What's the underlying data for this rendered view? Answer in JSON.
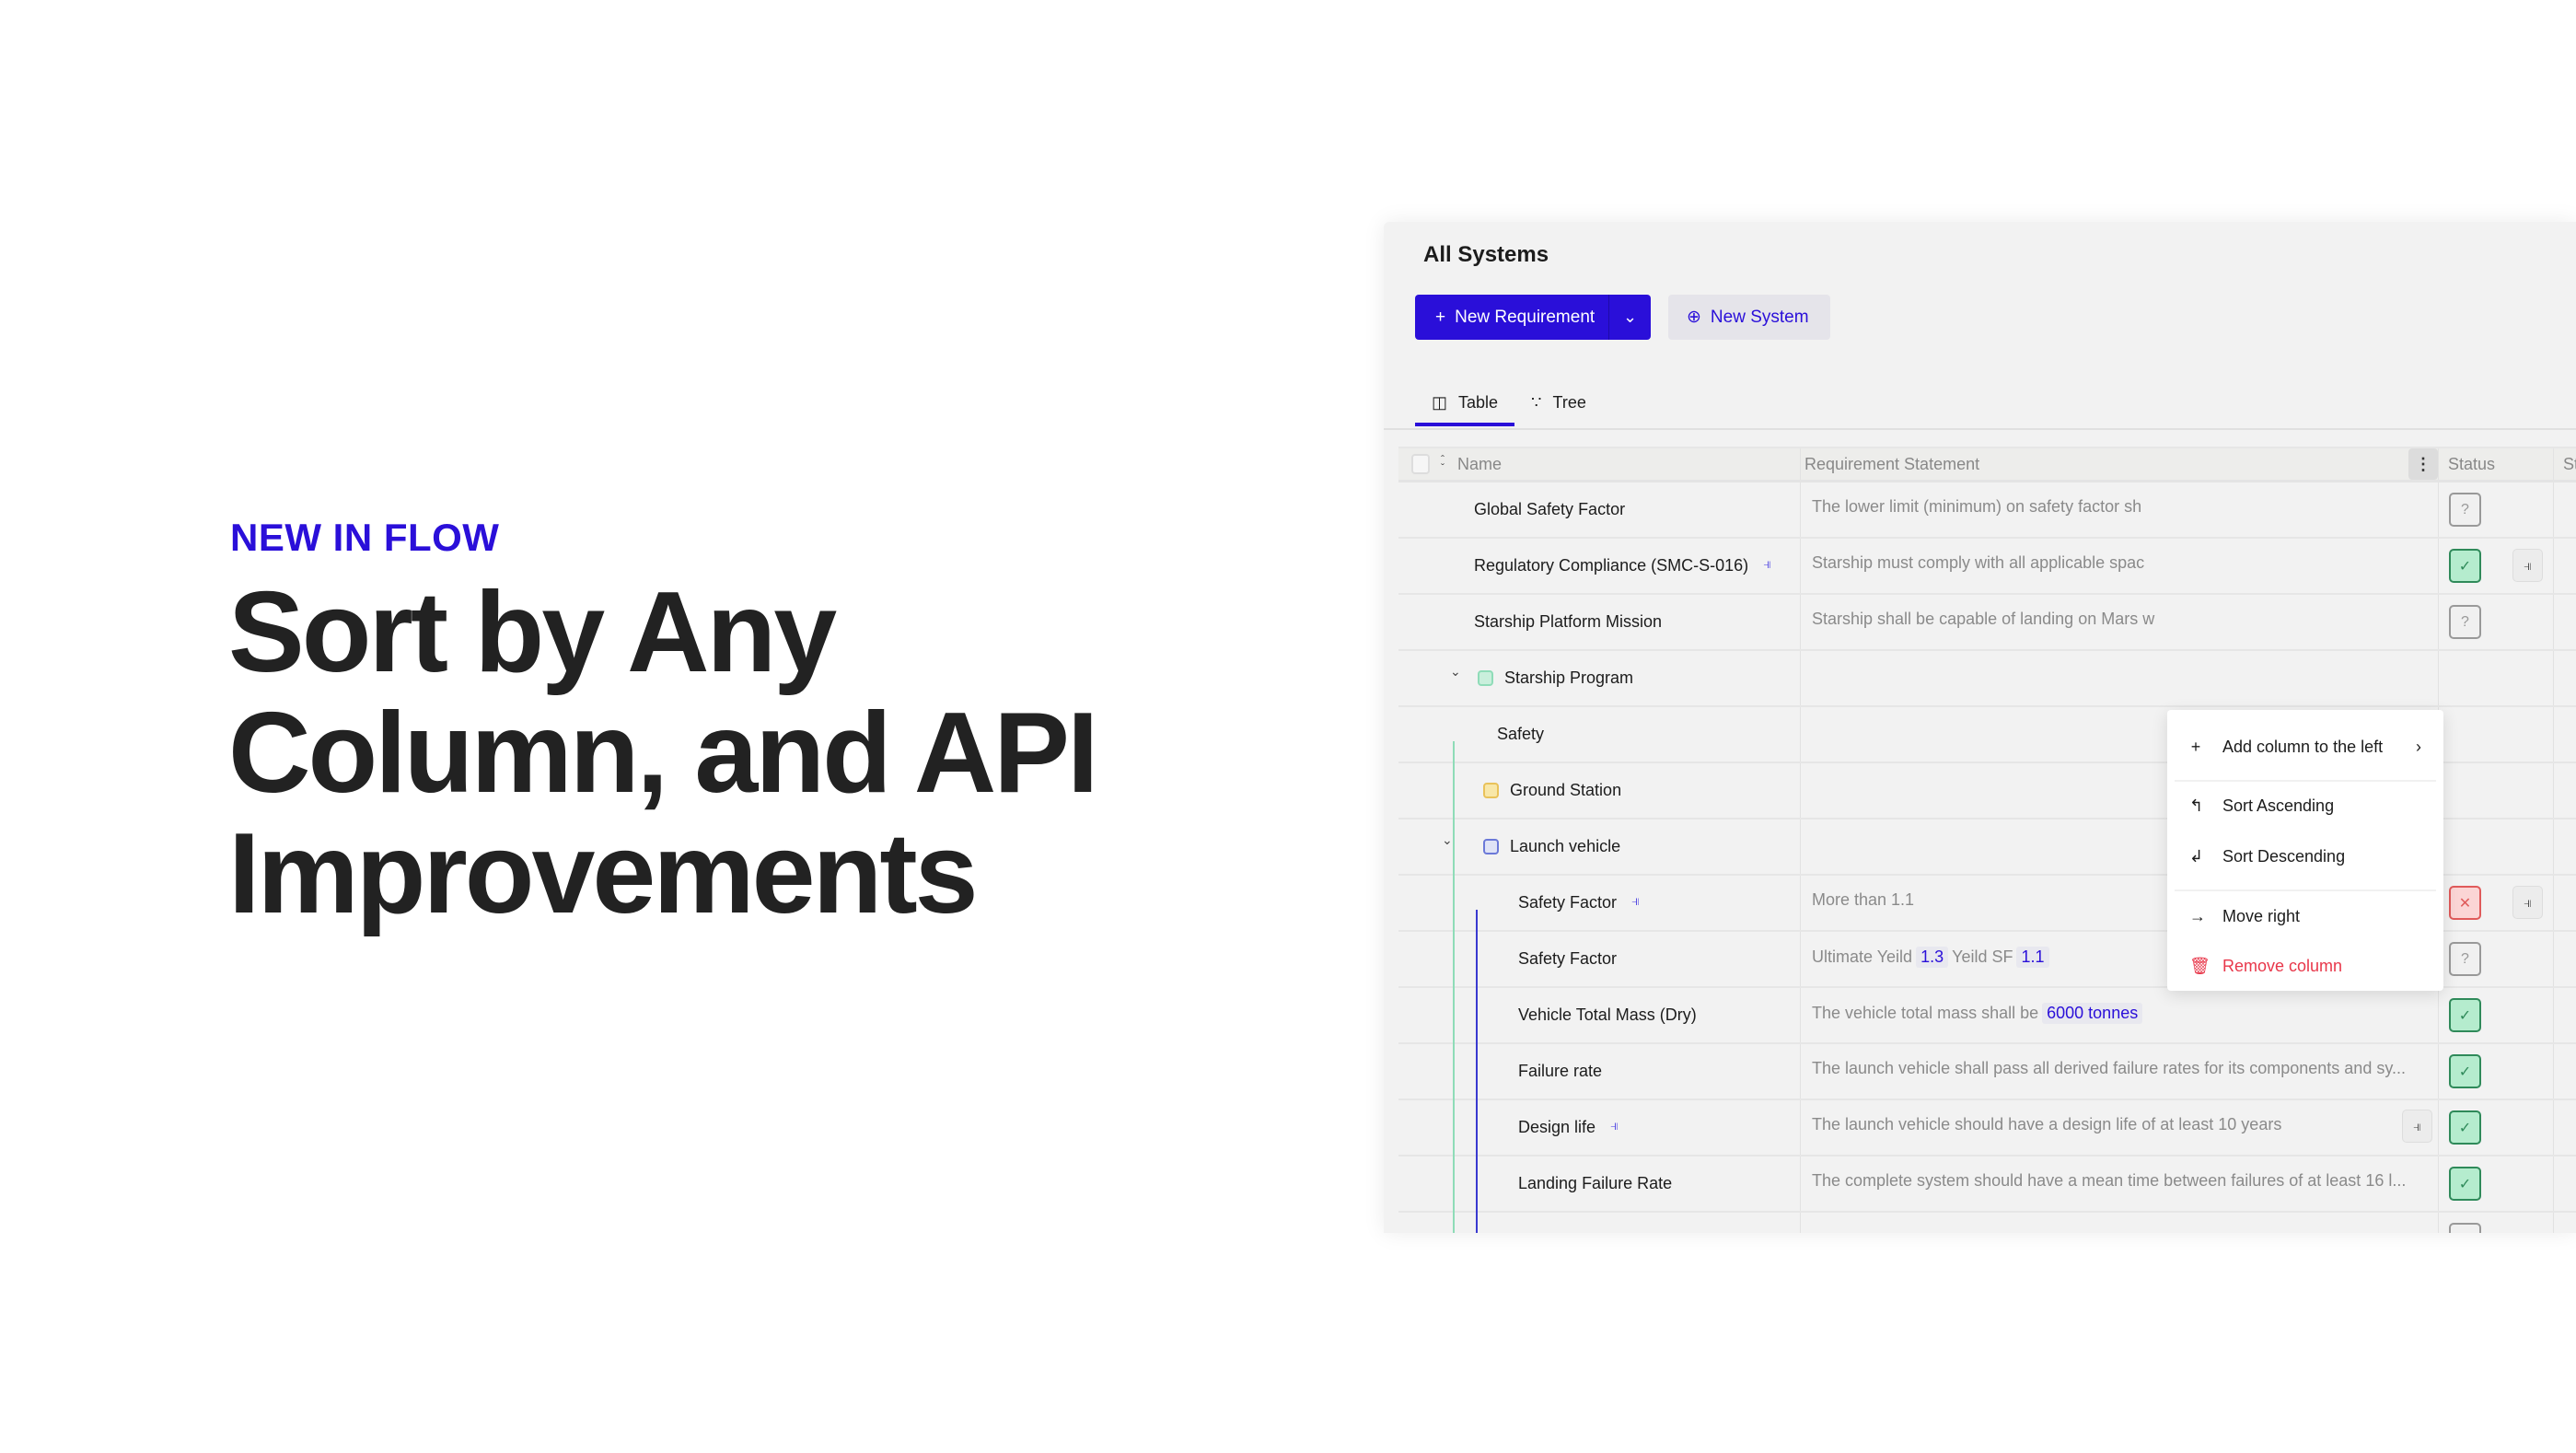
{
  "promo": {
    "kicker": "NEW IN FLOW",
    "headline_lines": [
      "Sort by Any",
      "Column, and API",
      "Improvements"
    ],
    "accent_color": "#2a0fd9"
  },
  "app": {
    "title": "All Systems",
    "new_requirement_label": "New Requirement",
    "new_system_label": "New System",
    "tabs": [
      {
        "label": "Table",
        "icon": "table-icon",
        "active": true
      },
      {
        "label": "Tree",
        "icon": "tree-icon",
        "active": false
      }
    ],
    "columns": {
      "name": "Name",
      "requirement": "Requirement Statement",
      "status": "Status",
      "extra": "St"
    },
    "rows": [
      {
        "name": "Global Safety Factor",
        "level": 0,
        "statement": [
          {
            "t": "The lower limit (minimum) on safety factor sh"
          }
        ],
        "status": "unknown"
      },
      {
        "name": "Regulatory Compliance (SMC-S-016)",
        "level": 0,
        "link": true,
        "statement": [
          {
            "t": "Starship must comply with all applicable spac"
          }
        ],
        "status": "pass",
        "extra_link": true
      },
      {
        "name": "Starship Platform Mission",
        "level": 0,
        "statement": [
          {
            "t": "Starship shall be capable of landing on Mars w"
          }
        ],
        "status": "unknown"
      },
      {
        "name": "Starship Program",
        "level": 0,
        "group": true,
        "expanded": true,
        "color": "green",
        "statement": []
      },
      {
        "name": "Safety",
        "level": 1,
        "statement": []
      },
      {
        "name": "Ground Station",
        "level": 1,
        "group": true,
        "color": "yellow",
        "statement": []
      },
      {
        "name": "Launch vehicle",
        "level": 1,
        "group": true,
        "expanded": true,
        "color": "blue",
        "statement": []
      },
      {
        "name": "Safety Factor",
        "level": 2,
        "link": true,
        "statement": [
          {
            "t": "More than 1.1"
          }
        ],
        "status": "fail",
        "extra_link": true
      },
      {
        "name": "Safety Factor",
        "level": 2,
        "statement": [
          {
            "t": "Ultimate Yeild"
          },
          {
            "t": "1.3",
            "hl": true
          },
          {
            "t": "Yeild SF"
          },
          {
            "t": "1.1",
            "hl": true
          }
        ],
        "status": "unknown"
      },
      {
        "name": "Vehicle Total Mass (Dry)",
        "level": 2,
        "statement": [
          {
            "t": "The vehicle total mass shall be"
          },
          {
            "t": "6000 tonnes",
            "hl": true
          }
        ],
        "status": "pass"
      },
      {
        "name": "Failure rate",
        "level": 2,
        "statement": [
          {
            "t": "The launch vehicle shall pass all derived failure rates for its components and sy..."
          }
        ],
        "status": "pass"
      },
      {
        "name": "Design life",
        "level": 2,
        "link": true,
        "statement": [
          {
            "t": "The launch vehicle should have a design life of at least 10 years"
          }
        ],
        "status": "pass",
        "inline_link": true
      },
      {
        "name": "Landing Failure Rate",
        "level": 2,
        "statement": [
          {
            "t": "The complete system should have a mean time between failures of at least 16 l..."
          }
        ],
        "status": "pass"
      },
      {
        "name": "",
        "level": 2,
        "statement": [],
        "status": "unknown"
      }
    ],
    "column_menu": {
      "add_left": "Add column to the left",
      "sort_asc": "Sort Ascending",
      "sort_desc": "Sort Descending",
      "move_right": "Move right",
      "remove": "Remove column"
    },
    "status_colors": {
      "pass": "#b5ecce",
      "fail": "#fbd5d5",
      "unknown": "#f0f0f0"
    }
  }
}
